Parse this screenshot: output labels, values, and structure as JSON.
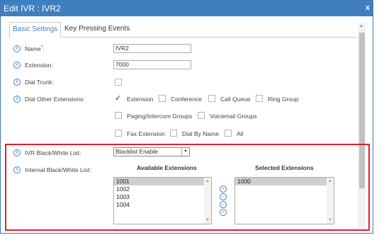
{
  "window": {
    "title": "Edit IVR : IVR2",
    "close_label": "x"
  },
  "tabs": [
    {
      "label": "Basic Settings",
      "active": true
    },
    {
      "label": "Key Pressing Events",
      "active": false
    }
  ],
  "fields": {
    "name": {
      "label": "Name",
      "required_mark": "*",
      "colon": ":",
      "value": "IVR2"
    },
    "extension": {
      "label": "Extension:",
      "value": "7000"
    },
    "dial_trunk": {
      "label": "Dial Trunk:",
      "checked": false
    },
    "dial_other": {
      "label": "Dial Other Extensions:",
      "options": [
        {
          "label": "Extension",
          "checked": true
        },
        {
          "label": "Conference",
          "checked": false
        },
        {
          "label": "Call Queue",
          "checked": false
        },
        {
          "label": "Ring Group",
          "checked": false
        },
        {
          "label": "Paging/Intercom Groups",
          "checked": false
        },
        {
          "label": "Voicemail Groups",
          "checked": false
        },
        {
          "label": "Fax Extension",
          "checked": false
        },
        {
          "label": "Dial By Name",
          "checked": false
        },
        {
          "label": "All",
          "checked": false
        }
      ]
    },
    "blackwhite_list": {
      "label": "IVR Black/White List:",
      "value": "Blacklist Enable"
    },
    "internal_list": {
      "label": "Internal Black/White List:",
      "available_header": "Available Extensions",
      "selected_header": "Selected Extensions",
      "available": [
        "1001",
        "1002",
        "1003",
        "1004"
      ],
      "selected": [
        "1000"
      ]
    }
  },
  "icons": {
    "info": "i",
    "move_all_right": "»",
    "move_right": "›",
    "move_left": "‹",
    "move_all_left": "«",
    "scroll_up": "▲",
    "scroll_down": "▼",
    "dropdown": "▼"
  },
  "colors": {
    "accent": "#3f7fbf",
    "highlight": "#d9232b"
  }
}
